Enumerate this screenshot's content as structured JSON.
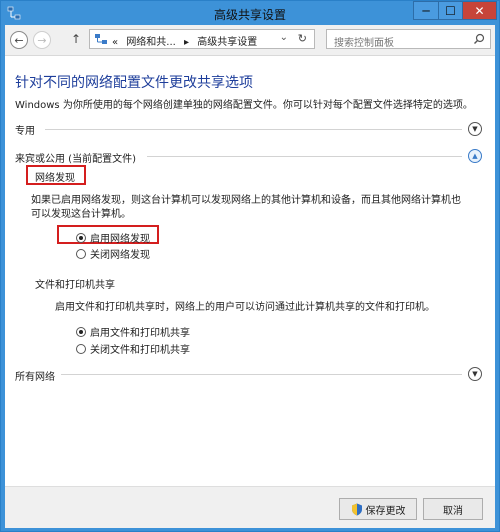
{
  "window": {
    "title": "高级共享设置",
    "controls": {
      "minimize": "─",
      "maximize": "☐",
      "close": "✕"
    }
  },
  "navbar": {
    "breadcrumb_prefix": "«",
    "breadcrumb_1": "网络和共...",
    "breadcrumb_sep": "▸",
    "breadcrumb_2": "高级共享设置",
    "search_placeholder": "搜索控制面板"
  },
  "content": {
    "heading": "针对不同的网络配置文件更改共享选项",
    "description": "Windows 为你所使用的每个网络创建单独的网络配置文件。你可以针对每个配置文件选择特定的选项。",
    "profiles": {
      "private": {
        "label": "专用",
        "expanded": false
      },
      "guest_public": {
        "label": "来宾或公用 (当前配置文件)",
        "expanded": true
      },
      "all_networks": {
        "label": "所有网络",
        "expanded": false
      }
    },
    "network_discovery": {
      "title": "网络发现",
      "description_line1": "如果已启用网络发现，则这台计算机可以发现网络上的其他计算机和设备，而且其他网络计算机也",
      "description_line2": "可以发现这台计算机。",
      "options": [
        {
          "label": "启用网络发现",
          "checked": true
        },
        {
          "label": "关闭网络发现",
          "checked": false
        }
      ]
    },
    "file_printer_sharing": {
      "title": "文件和打印机共享",
      "description": "启用文件和打印机共享时，网络上的用户可以访问通过此计算机共享的文件和打印机。",
      "options": [
        {
          "label": "启用文件和打印机共享",
          "checked": true
        },
        {
          "label": "关闭文件和打印机共享",
          "checked": false
        }
      ]
    }
  },
  "footer": {
    "save_label": "保存更改",
    "cancel_label": "取消"
  },
  "colors": {
    "titlebar": "#3d92d8",
    "heading": "#1e3e9b",
    "highlight_box": "#d41e1e",
    "close_button": "#c7443a"
  }
}
